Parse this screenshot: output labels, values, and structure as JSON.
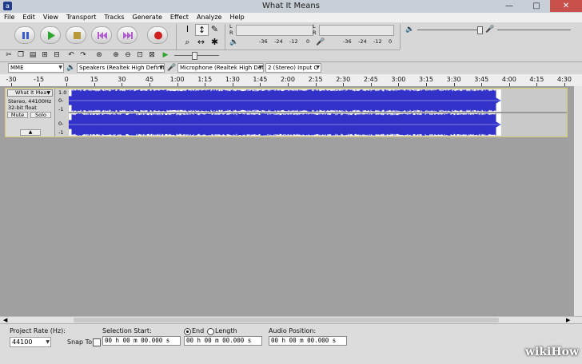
{
  "window": {
    "title": "What It Means",
    "minimize": "—",
    "maximize": "□",
    "close": "✕",
    "app_icon": "a"
  },
  "menu": [
    "File",
    "Edit",
    "View",
    "Transport",
    "Tracks",
    "Generate",
    "Effect",
    "Analyze",
    "Help"
  ],
  "transport": {
    "buttons": [
      {
        "name": "pause-button",
        "icon": "pause-icon",
        "color": "#3a5bd0"
      },
      {
        "name": "play-button",
        "icon": "play-icon",
        "color": "#2ea52e"
      },
      {
        "name": "stop-button",
        "icon": "stop-icon",
        "color": "#b89a3a"
      },
      {
        "name": "skip-start-button",
        "icon": "skip-start-icon",
        "color": "#b05ad0"
      },
      {
        "name": "skip-end-button",
        "icon": "skip-end-icon",
        "color": "#b05ad0"
      },
      {
        "name": "record-button",
        "icon": "record-icon",
        "color": "#d02020"
      }
    ]
  },
  "tools": [
    "I",
    "↕",
    "✎",
    "⌕",
    "↔",
    "✱"
  ],
  "meters": {
    "play_scale": [
      "-36",
      "-24",
      "-12",
      "0"
    ],
    "record_scale": [
      "-36",
      "-24",
      "-12",
      "0"
    ],
    "channel_l": "L",
    "channel_r": "R"
  },
  "device_bar": {
    "host": "MME",
    "output_device": "Speakers (Realtek High Definit",
    "input_device": "Microphone (Realtek High Defi",
    "channels": "2 (Stereo) Input C"
  },
  "ruler": {
    "ticks": [
      "-30",
      "-15",
      "0",
      "15",
      "30",
      "45",
      "1:00",
      "1:15",
      "1:30",
      "1:45",
      "2:00",
      "2:15",
      "2:30",
      "2:45",
      "3:00",
      "3:15",
      "3:30",
      "3:45",
      "4:00",
      "4:15",
      "4:30"
    ]
  },
  "track": {
    "name": "What It Mea",
    "format_line1": "Stereo, 44100Hz",
    "format_line2": "32-bit float",
    "mute": "Mute",
    "solo": "Solo",
    "scale_top": "1.0",
    "scale_mid": "0-",
    "scale_bot": "-1",
    "wave_color": "#3232c8",
    "audio_end_fraction": 0.868
  },
  "selection_toolbar": {
    "project_rate_label": "Project Rate (Hz):",
    "project_rate": "44100",
    "snap_to_label": "Snap To",
    "selection_start_label": "Selection Start:",
    "end_label": "End",
    "length_label": "Length",
    "audio_position_label": "Audio Position:",
    "selection_start": "00 h 00 m 00.000 s",
    "selection_end": "00 h 00 m 00.000 s",
    "audio_position": "00 h 00 m 00.000 s"
  },
  "watermark": "wikiHow"
}
